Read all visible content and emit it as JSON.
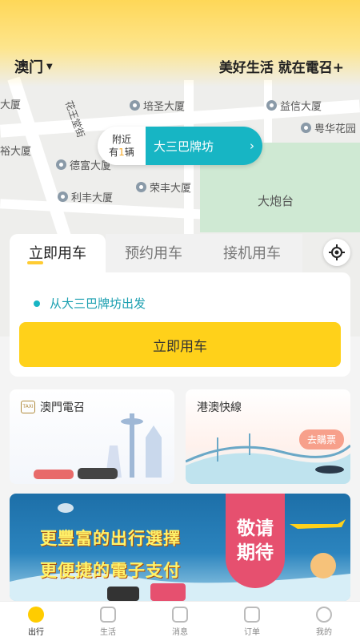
{
  "header": {
    "city": "澳门",
    "slogan": "美好生活 就在電召+"
  },
  "map": {
    "labels": {
      "peiseng": "培圣大厦",
      "yixin": "益信大厦",
      "yuehua": "粤华花园",
      "dafu": "德富大厦",
      "lifeng": "利丰大厦",
      "rongfeng": "荣丰大厦",
      "dapaotai": "大炮台",
      "daxia_left": "大厦",
      "yu_daxia": "裕大厦",
      "road": "花王堂街"
    }
  },
  "nearby": {
    "line1": "附近",
    "count_prefix": "有",
    "count": "1",
    "count_suffix": "辆",
    "place": "大三巴牌坊"
  },
  "booking": {
    "tabs": [
      "立即用车",
      "预约用车",
      "接机用车"
    ],
    "from": "从大三巴牌坊出发",
    "button": "立即用车"
  },
  "services": {
    "macau_taxi": "澳門電召",
    "hk_macau": "港澳快線",
    "buy": "去購票",
    "taxi_logo": "TAXI"
  },
  "banner": {
    "line1": "更豐富的出行選擇",
    "line2": "更便捷的電子支付",
    "tag1": "敬请",
    "tag2": "期待"
  },
  "nav": {
    "items": [
      "出行",
      "生活",
      "消息",
      "订单",
      "我的"
    ]
  },
  "colors": {
    "accent": "#ffd11a",
    "teal": "#17b5c4"
  }
}
